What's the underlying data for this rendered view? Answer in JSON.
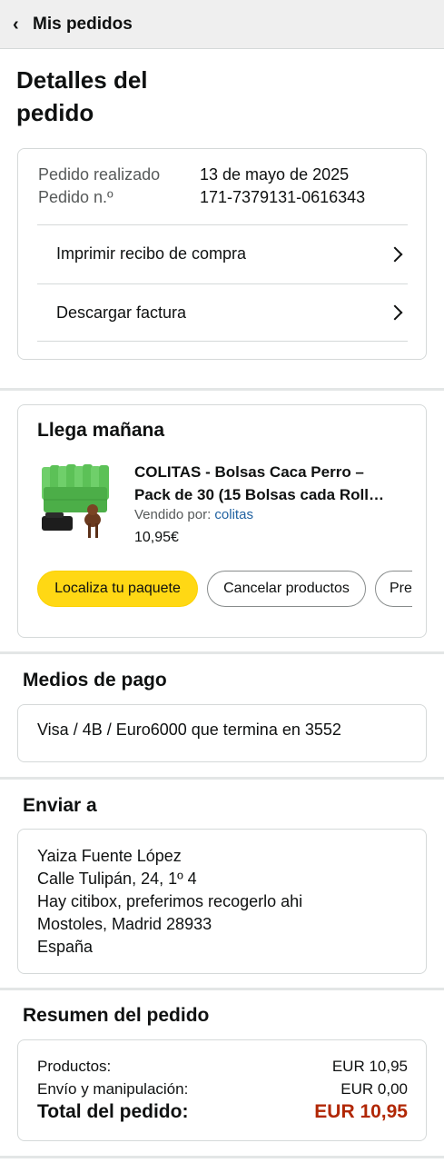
{
  "header": {
    "title": "Mis pedidos"
  },
  "page": {
    "title": "Detalles del pedido"
  },
  "order_info": {
    "placed_label": "Pedido realizado",
    "placed_value": "13 de mayo de 2025",
    "number_label": "Pedido n.º",
    "number_value": "171-7379131-0616343",
    "links": [
      {
        "label": "Imprimir recibo de compra"
      },
      {
        "label": "Descargar factura"
      }
    ]
  },
  "shipment": {
    "arrival": "Llega mañana",
    "product": {
      "title_line1": "COLITAS - Bolsas Caca Perro –",
      "title_line2": "Pack de 30 (15 Bolsas cada Roll…",
      "seller_prefix": "Vendido por:",
      "seller_name": "colitas",
      "price": "10,95€",
      "thumb_icon": "product-image"
    },
    "buttons": [
      {
        "label": "Localiza tu paquete"
      },
      {
        "label": "Cancelar productos"
      },
      {
        "label": "Pre"
      }
    ]
  },
  "payment": {
    "heading": "Medios de pago",
    "method": "Visa / 4B / Euro6000  que termina en 3552"
  },
  "shipping": {
    "heading": "Enviar a",
    "lines": [
      "Yaiza Fuente López",
      "Calle Tulipán, 24, 1º 4",
      "Hay citibox, preferimos recogerlo ahi",
      "Mostoles, Madrid 28933",
      "España"
    ]
  },
  "summary": {
    "heading": "Resumen del pedido",
    "rows": [
      {
        "label": "Productos:",
        "value": "EUR 10,95"
      },
      {
        "label": "Envío y manipulación:",
        "value": "EUR 0,00"
      }
    ],
    "total_label": "Total del pedido:",
    "total_value": "EUR 10,95"
  },
  "colors": {
    "accent_yellow": "#ffd814",
    "link_blue": "#2162a1",
    "total_red": "#b12704"
  }
}
